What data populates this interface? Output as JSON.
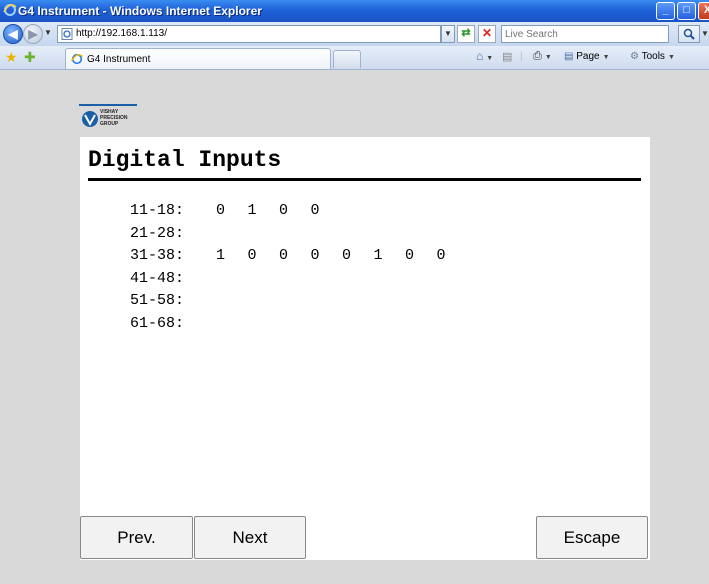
{
  "window": {
    "title": "G4 Instrument - Windows Internet Explorer",
    "minimize": "_",
    "maximize": "□",
    "close": "X"
  },
  "address_bar": {
    "url": "http://192.168.1.113/",
    "search_placeholder": "Live Search"
  },
  "tab_bar": {
    "tab_label": "G4 Instrument",
    "page_label": "Page",
    "tools_label": "Tools"
  },
  "logo": {
    "line1": "VISHAY",
    "line2": "PRECISION",
    "line3": "GROUP"
  },
  "page": {
    "title": "Digital Inputs",
    "rows": [
      {
        "label": "11-18:",
        "values": [
          "0",
          "1",
          "0",
          "0"
        ]
      },
      {
        "label": "21-28:",
        "values": []
      },
      {
        "label": "31-38:",
        "values": [
          "1",
          "0",
          "0",
          "0",
          "0",
          "1",
          "0",
          "0"
        ]
      },
      {
        "label": "41-48:",
        "values": []
      },
      {
        "label": "51-58:",
        "values": []
      },
      {
        "label": "61-68:",
        "values": []
      }
    ]
  },
  "buttons": {
    "prev": "Prev.",
    "next": "Next",
    "escape": "Escape"
  }
}
